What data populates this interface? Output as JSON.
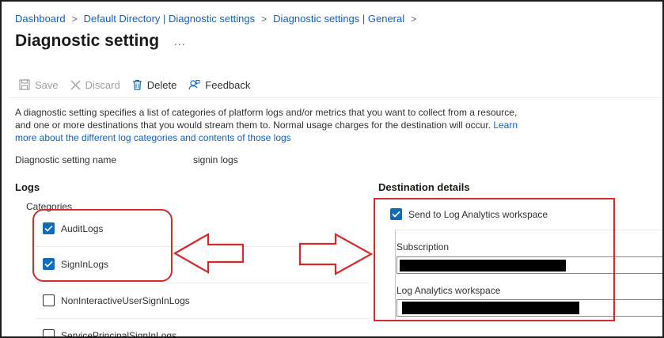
{
  "breadcrumb": {
    "items": [
      "Dashboard",
      "Default Directory | Diagnostic settings",
      "Diagnostic settings | General"
    ],
    "separator": ">"
  },
  "page": {
    "title": "Diagnostic setting",
    "more": "..."
  },
  "toolbar": {
    "save": "Save",
    "discard": "Discard",
    "delete": "Delete",
    "feedback": "Feedback"
  },
  "description": {
    "text": "A diagnostic setting specifies a list of categories of platform logs and/or metrics that you want to collect from a resource, and one or more destinations that you would stream them to. Normal usage charges for the destination will occur. ",
    "link": "Learn more about the different log categories and contents of those logs"
  },
  "setting_name": {
    "label": "Diagnostic setting name",
    "value": "signin logs"
  },
  "logs": {
    "heading": "Logs",
    "categories_label": "Categories",
    "items": [
      {
        "label": "AuditLogs",
        "checked": true
      },
      {
        "label": "SignInLogs",
        "checked": true
      },
      {
        "label": "NonInteractiveUserSignInLogs",
        "checked": false
      },
      {
        "label": "ServicePrincipalSignInLogs",
        "checked": false
      }
    ]
  },
  "destination": {
    "heading": "Destination details",
    "send_to_log_analytics": {
      "label": "Send to Log Analytics workspace",
      "checked": true
    },
    "subscription_label": "Subscription",
    "workspace_label": "Log Analytics workspace"
  },
  "colors": {
    "link": "#0f62c1",
    "checkbox": "#0f6cbd",
    "annotation": "#d42a2a"
  }
}
